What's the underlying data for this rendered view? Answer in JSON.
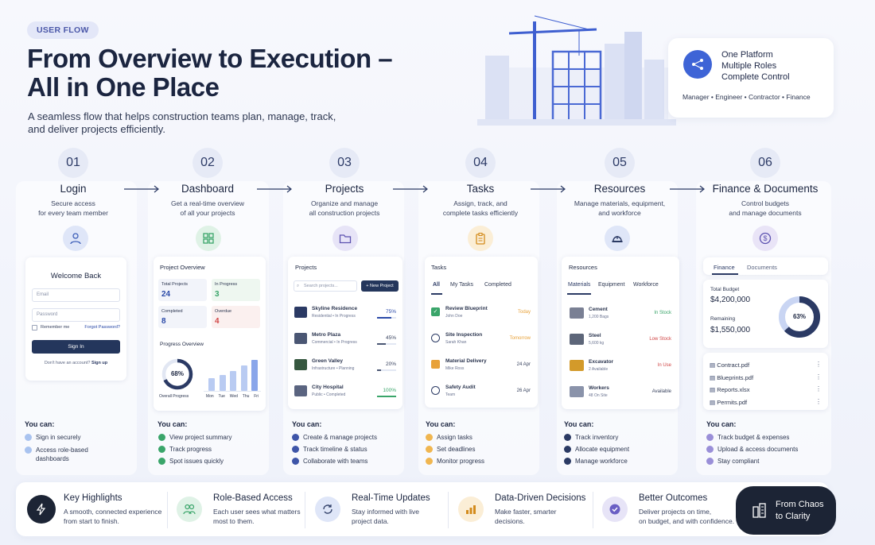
{
  "tag": "USER FLOW",
  "title": [
    "From Overview to Execution –",
    "All in One Place"
  ],
  "subtitle": [
    "A seamless flow that helps construction teams plan, manage, track,",
    "and deliver projects efficiently."
  ],
  "platform": {
    "lines": [
      "One Platform",
      "Multiple Roles",
      "Complete Control"
    ],
    "roles": "Manager • Engineer • Contractor • Finance"
  },
  "steps": [
    {
      "num": "01",
      "name": "Login",
      "desc": [
        "Secure access",
        "for every team member"
      ]
    },
    {
      "num": "02",
      "name": "Dashboard",
      "desc": [
        "Get a real-time overview",
        "of all your projects"
      ]
    },
    {
      "num": "03",
      "name": "Projects",
      "desc": [
        "Organize and manage",
        "all construction projects"
      ]
    },
    {
      "num": "04",
      "name": "Tasks",
      "desc": [
        "Assign, track, and",
        "complete tasks efficiently"
      ]
    },
    {
      "num": "05",
      "name": "Resources",
      "desc": [
        "Manage materials, equipment,",
        "and workforce"
      ]
    },
    {
      "num": "06",
      "name": "Finance & Documents",
      "desc": [
        "Control budgets",
        "and manage documents"
      ]
    }
  ],
  "login": {
    "title": "Welcome Back",
    "email": "Email",
    "password": "Password",
    "remember": "Remember me",
    "forgot": "Forgot Password?",
    "signin": "Sign In",
    "noacc": "Don't have an account?",
    "signup": "Sign up"
  },
  "dashboard": {
    "title": "Project Overview",
    "stats": [
      {
        "label": "Total Projects",
        "value": "24"
      },
      {
        "label": "In Progress",
        "value": "3"
      },
      {
        "label": "Completed",
        "value": "8"
      },
      {
        "label": "Overdue",
        "value": "4"
      }
    ],
    "progress_title": "Progress Overview",
    "percent": "68%",
    "percent_value": 68,
    "overall": "Overall Progress",
    "days": [
      "Mon",
      "Tue",
      "Wed",
      "Thu",
      "Fri"
    ],
    "bars": [
      0.38,
      0.5,
      0.62,
      0.78,
      0.95
    ]
  },
  "projects": {
    "title": "Projects",
    "search": "Search projects...",
    "new": "+ New Project",
    "items": [
      {
        "name": "Skyline Residence",
        "sub": "Residential • In Progress",
        "pct": "75%",
        "fill": 0.75
      },
      {
        "name": "Metro Plaza",
        "sub": "Commercial • In Progress",
        "pct": "45%",
        "fill": 0.45
      },
      {
        "name": "Green Valley",
        "sub": "Infrastructure • Planning",
        "pct": "20%",
        "fill": 0.2
      },
      {
        "name": "City Hospital",
        "sub": "Public • Completed",
        "pct": "100%",
        "fill": 1.0
      }
    ]
  },
  "tasks": {
    "title": "Tasks",
    "tabs": [
      "All",
      "My Tasks",
      "Completed"
    ],
    "items": [
      {
        "name": "Review Blueprint",
        "who": "John Doe",
        "due": "Today"
      },
      {
        "name": "Site Inspection",
        "who": "Sarah Khan",
        "due": "Tomorrow"
      },
      {
        "name": "Material Delivery",
        "who": "Mike Ross",
        "due": "24 Apr"
      },
      {
        "name": "Safety Audit",
        "who": "Team",
        "due": "26 Apr"
      }
    ]
  },
  "resources": {
    "title": "Resources",
    "tabs": [
      "Materials",
      "Equipment",
      "Workforce"
    ],
    "items": [
      {
        "name": "Cement",
        "qty": "1,200 Bags",
        "status": "In Stock"
      },
      {
        "name": "Steel",
        "qty": "5,600 kg",
        "status": "Low Stock"
      },
      {
        "name": "Excavator",
        "qty": "2 Available",
        "status": "In Use"
      },
      {
        "name": "Workers",
        "qty": "48 On Site",
        "status": "Available"
      }
    ]
  },
  "finance": {
    "tabs": [
      "Finance",
      "Documents"
    ],
    "budget_label": "Total Budget",
    "budget": "$4,200,000",
    "remaining_label": "Remaining",
    "remaining": "$1,550,000",
    "percent": "63%",
    "percent_value": 63,
    "docs": [
      "Contract.pdf",
      "Blueprints.pdf",
      "Reports.xlsx",
      "Permits.pdf"
    ]
  },
  "youcan": "You can:",
  "bullets": [
    [
      "Sign in securely",
      "Access role-based dashboards"
    ],
    [
      "View project summary",
      "Track progress",
      "Spot issues quickly"
    ],
    [
      "Create & manage projects",
      "Track timeline & status",
      "Collaborate with teams"
    ],
    [
      "Assign tasks",
      "Set deadlines",
      "Monitor progress"
    ],
    [
      "Track inventory",
      "Allocate equipment",
      "Manage workforce"
    ],
    [
      "Track budget & expenses",
      "Upload & access documents",
      "Stay compliant"
    ]
  ],
  "highlights": [
    {
      "title": "Key Highlights",
      "desc": [
        "A smooth, connected experience",
        "from start to finish."
      ]
    },
    {
      "title": "Role-Based Access",
      "desc": [
        "Each user sees what matters",
        "most to them."
      ]
    },
    {
      "title": "Real-Time Updates",
      "desc": [
        "Stay informed with live",
        "project data."
      ]
    },
    {
      "title": "Data-Driven Decisions",
      "desc": [
        "Make faster, smarter",
        "decisions."
      ]
    },
    {
      "title": "Better Outcomes",
      "desc": [
        "Deliver projects on time,",
        "on budget, and with confidence."
      ]
    }
  ],
  "cta": [
    "From Chaos",
    "to Clarity"
  ],
  "colors": {
    "blue": "#3e64d6",
    "navy": "#2b3a64",
    "green": "#3aa56a",
    "orange": "#e8a23a",
    "red": "#d04646"
  }
}
